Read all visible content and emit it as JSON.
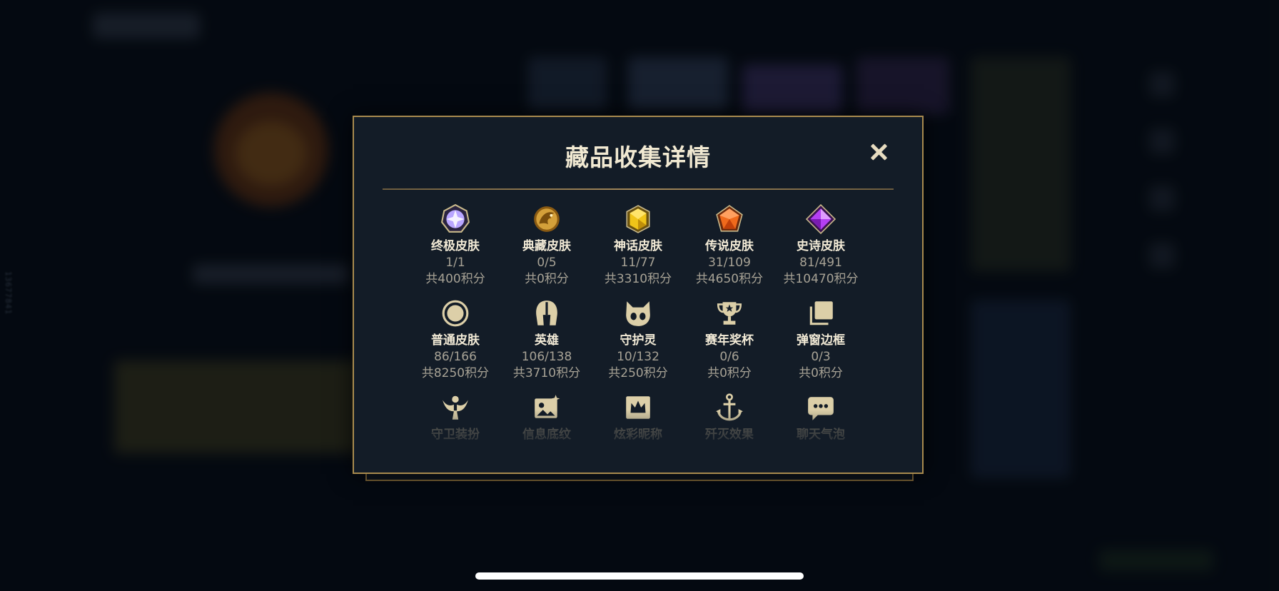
{
  "background": {
    "side_id": "13677841"
  },
  "modal": {
    "title": "藏品收集详情",
    "close_icon": "close-icon",
    "items": [
      {
        "name": "终极皮肤",
        "count": "1/1",
        "points": "共400积分",
        "icon": "crystal-gem-icon",
        "color": "#b9a6ff"
      },
      {
        "name": "典藏皮肤",
        "count": "0/5",
        "points": "共0积分",
        "icon": "gold-dragon-icon",
        "color": "#d4a03a"
      },
      {
        "name": "神话皮肤",
        "count": "11/77",
        "points": "共3310积分",
        "icon": "yellow-gem-icon",
        "color": "#f0c419"
      },
      {
        "name": "传说皮肤",
        "count": "31/109",
        "points": "共4650积分",
        "icon": "orange-gem-icon",
        "color": "#f06a1c"
      },
      {
        "name": "史诗皮肤",
        "count": "81/491",
        "points": "共10470积分",
        "icon": "purple-gem-icon",
        "color": "#b43ff2"
      },
      {
        "name": "普通皮肤",
        "count": "86/166",
        "points": "共8250积分",
        "icon": "circle-icon",
        "color": "#dccfa8"
      },
      {
        "name": "英雄",
        "count": "106/138",
        "points": "共3710积分",
        "icon": "helmet-icon",
        "color": "#dccfa8"
      },
      {
        "name": "守护灵",
        "count": "10/132",
        "points": "共250积分",
        "icon": "guardian-pet-icon",
        "color": "#dccfa8"
      },
      {
        "name": "赛年奖杯",
        "count": "0/6",
        "points": "共0积分",
        "icon": "trophy-icon",
        "color": "#dccfa8"
      },
      {
        "name": "弹窗边框",
        "count": "0/3",
        "points": "共0积分",
        "icon": "frames-icon",
        "color": "#dccfa8"
      },
      {
        "name": "守卫装扮",
        "icon": "ward-icon",
        "color": "#dccfa8"
      },
      {
        "name": "信息底纹",
        "icon": "info-card-icon",
        "color": "#dccfa8"
      },
      {
        "name": "炫彩昵称",
        "icon": "crown-card-icon",
        "color": "#dccfa8"
      },
      {
        "name": "歼灭效果",
        "icon": "anchor-icon",
        "color": "#dccfa8"
      },
      {
        "name": "聊天气泡",
        "icon": "chat-bubble-icon",
        "color": "#dccfa8"
      }
    ]
  },
  "colors": {
    "accent_gold": "#a88a4e",
    "panel": "#131c27"
  }
}
